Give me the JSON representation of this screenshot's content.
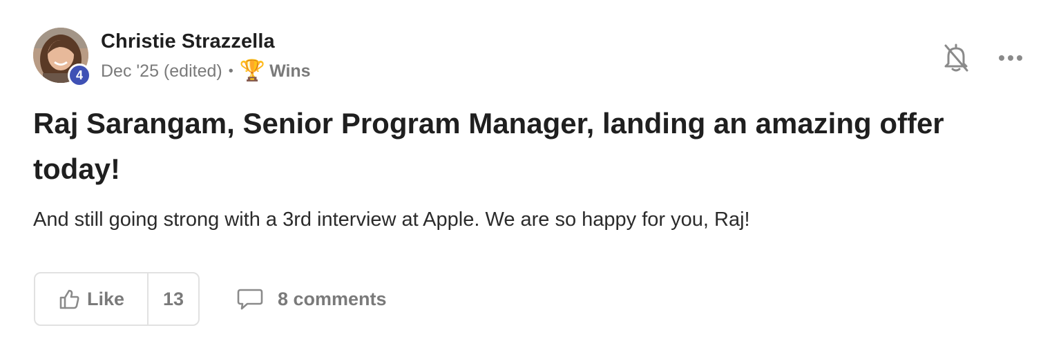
{
  "post": {
    "author": {
      "name": "Christie Strazzella",
      "level": "4",
      "level_color": "#3f51b5"
    },
    "meta": {
      "date": "Dec '25 (edited)",
      "separator": "•",
      "category_icon": "🏆",
      "category": "Wins"
    },
    "title": "Raj Sarangam, Senior Program Manager, landing an amazing offer today!",
    "body": "And still going strong with a 3rd interview at Apple. We are so happy for you, Raj!",
    "actions": {
      "like_label": "Like",
      "like_count": "13",
      "comments_label": "8 comments"
    },
    "icons": {
      "notifications": "bell-off-icon",
      "more": "more-horizontal-icon",
      "like": "thumbs-up-icon",
      "comments": "comment-bubble-icon"
    }
  }
}
